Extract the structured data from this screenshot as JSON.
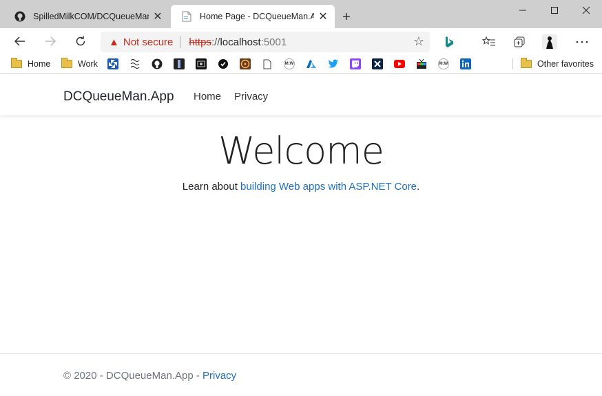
{
  "browser": {
    "tabs": [
      {
        "title": "SpilledMilkCOM/DCQueueMan: Da",
        "active": false,
        "icon": "github-icon"
      },
      {
        "title": "Home Page - DCQueueMan.App",
        "active": true,
        "icon": "page-icon"
      }
    ],
    "new_tab": "+",
    "window_controls": {
      "minimize": "—",
      "maximize": "☐",
      "close": "✕"
    },
    "security_label": "Not secure",
    "url": {
      "scheme": "https",
      "rest": "://",
      "host": "localhost",
      "port": ":5001"
    },
    "favorites": [
      {
        "label": "Home",
        "icon": "folder-icon"
      },
      {
        "label": "Work",
        "icon": "folder-icon"
      }
    ],
    "favicons": [
      "chase-icon",
      "pattern-icon",
      "github-icon",
      "bar-icon",
      "dark-icon",
      "check-icon",
      "film-icon",
      "document-icon",
      "mw-icon",
      "azure-icon",
      "twitter-icon",
      "twitch-icon",
      "x-icon",
      "youtube-icon",
      "tv-icon",
      "mw-icon",
      "linkedin-icon"
    ],
    "other_favorites": "Other favorites"
  },
  "site": {
    "brand": "DCQueueMan.App",
    "nav": [
      "Home",
      "Privacy"
    ],
    "heading": "Welcome",
    "lead_prefix": "Learn about ",
    "lead_link": "building Web apps with ASP.NET Core",
    "lead_suffix": ".",
    "footer_prefix": "© 2020 - DCQueueMan.App - ",
    "footer_link": "Privacy"
  },
  "colors": {
    "link": "#1b6ec2",
    "warning": "#c42b1c",
    "titlebar": "#cfcfcf"
  }
}
